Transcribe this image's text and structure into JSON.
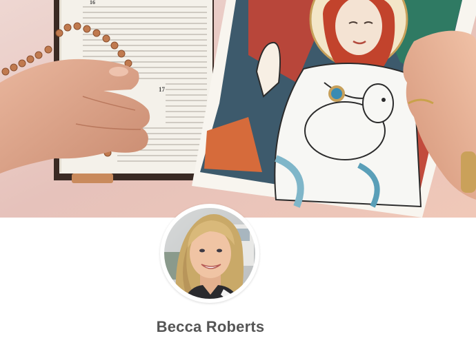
{
  "profile": {
    "name": "Becca Roberts"
  },
  "cover": {
    "image": "cover-photo",
    "bible_verse_numbers": [
      "16",
      "17"
    ]
  },
  "avatar": {
    "image": "profile-photo"
  }
}
